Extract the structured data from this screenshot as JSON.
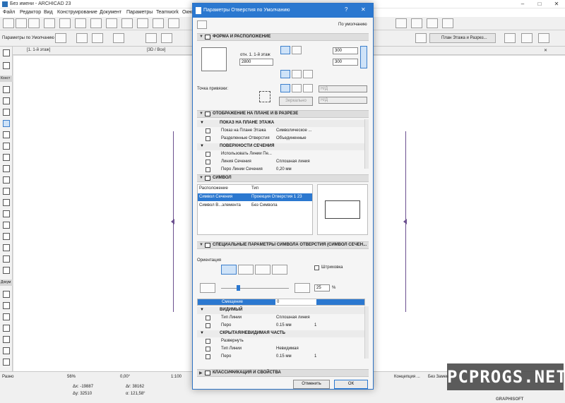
{
  "app": {
    "title": "Без имени - ARCHICAD 23"
  },
  "menu": [
    "Файл",
    "Редактор",
    "Вид",
    "Конструирование",
    "Документ",
    "Параметры",
    "Teamwork",
    "Окно"
  ],
  "toolbar": {
    "defaults_label": "Параметры по Умолчанию",
    "view_map": "План Этажа и Разрез...",
    "construct_tab": "Конструиров"
  },
  "tabs": {
    "floor": "[1. 1-й этаж]",
    "3d": "[3D / Все]"
  },
  "toolbox": {
    "design": "Конст",
    "docs": "Докум"
  },
  "dialog": {
    "title": "Параметры Отверстия по Умолчанию",
    "help": "?",
    "close": "✕",
    "preset": "По умолчанию",
    "sections": {
      "form": "ФОРМА И РАСПОЛОЖЕНИЕ",
      "display": "ОТОБРАЖЕНИЕ НА ПЛАНЕ И В РАЗРЕЗЕ",
      "symbol": "СИМВОЛ",
      "special": "СПЕЦИАЛЬНЫЕ ПАРАМЕТРЫ СИМВОЛА ОТВЕРСТИЯ (СИМВОЛ СЕЧЕН...",
      "classification": "КЛАССИФИКАЦИЯ И СВОЙСТВА"
    },
    "form": {
      "elev_label": "отн. 1. 1-й этаж",
      "elev_value": "2800",
      "width": "300",
      "height": "300",
      "anchor_label": "Точка привязки:",
      "nd1": "Н/Д",
      "nd2": "Н/Д",
      "mirror": "Зеркально"
    },
    "display_rows": [
      {
        "name": "ПОКАЗ НА ПЛАНЕ ЭТАЖА",
        "value": "",
        "header": true
      },
      {
        "name": "Показ на Плане Этажа",
        "value": "Символическое ...",
        "header": false
      },
      {
        "name": "Разделенные Отверстия",
        "value": "Объединенные",
        "header": false
      },
      {
        "name": "ПОВЕРХНОСТИ СЕЧЕНИЯ",
        "value": "",
        "header": true
      },
      {
        "name": "Использовать Линии Пе...",
        "value": "",
        "header": false
      },
      {
        "name": "Линия Сечения",
        "value": "Сплошная линия",
        "header": false
      },
      {
        "name": "Перо Линии Сечения",
        "value": "0,20 мм",
        "header": false
      }
    ],
    "symbol": {
      "col_position": "Расположение",
      "col_type": "Тип",
      "rows": [
        {
          "position": "Символ Сечения",
          "type": "Проекция Отверстия 1 23"
        },
        {
          "position": "Символ В...элемента",
          "type": "Без Символа"
        }
      ]
    },
    "special": {
      "orientation": "Ориентация",
      "hatch": "Штриховка",
      "percent_value": "25",
      "percent_unit": "%",
      "offset_label": "Смещение",
      "offset_value": "0",
      "offset_percent": 0.0,
      "rows": [
        {
          "name": "ВИДИМЫЙ",
          "value": "",
          "extra": "",
          "header": true
        },
        {
          "name": "Тип Линии",
          "value": "Сплошная линия",
          "extra": "",
          "header": false
        },
        {
          "name": "Перо",
          "value": "0.15 мм",
          "extra": "1",
          "header": false
        },
        {
          "name": "СКРЫТАЯ/НЕВИДИМАЯ ЧАСТЬ",
          "value": "",
          "extra": "",
          "header": true
        },
        {
          "name": "Развернуть",
          "value": "",
          "extra": "",
          "header": false
        },
        {
          "name": "Тип Линии",
          "value": "Невидимая",
          "extra": "",
          "header": false
        },
        {
          "name": "Перо",
          "value": "0.15 мм",
          "extra": "1",
          "header": false
        }
      ]
    },
    "buttons": {
      "cancel": "Отменить",
      "ok": "ОК"
    }
  },
  "status": {
    "mode": "Разно",
    "zoom": "56%",
    "angle": "0,00°",
    "scale": "1:100",
    "dx_label": "Δx: -19887",
    "dy_label": "Δy: 32510",
    "ax_label": "Δr: 38162",
    "ay_label": "α: 121,58°",
    "concept": "Концепция ...",
    "change": "Без Замен...",
    "brand": "GRAPHISOFT"
  },
  "watermark": "PCPROGS.NET"
}
